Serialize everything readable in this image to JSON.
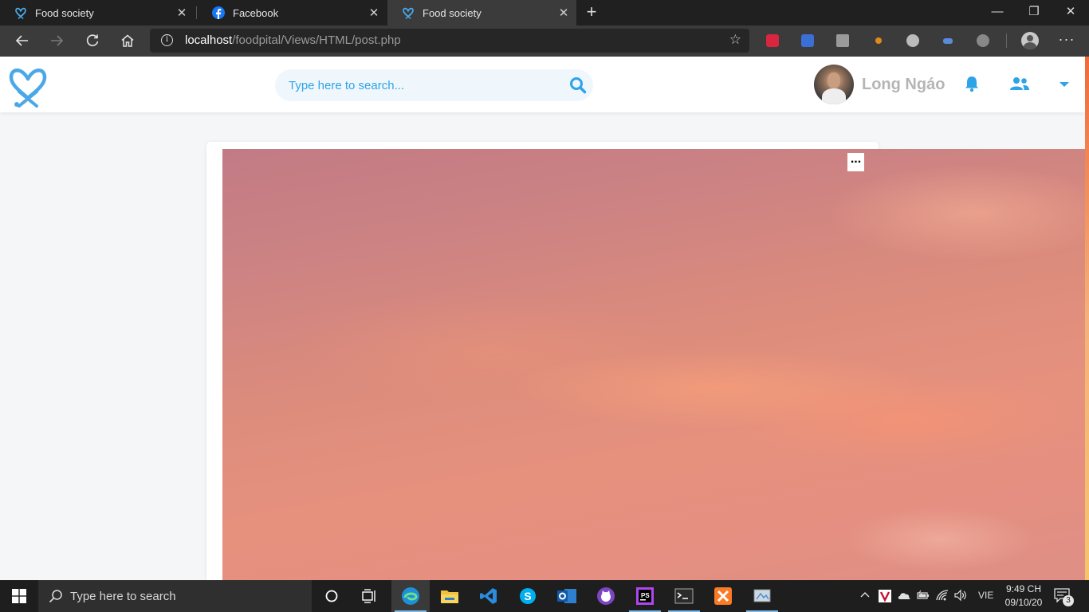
{
  "browser": {
    "tabs": [
      {
        "title": "Food society",
        "active": false,
        "favicon": "food-society-logo-icon"
      },
      {
        "title": "Facebook",
        "active": false,
        "favicon": "facebook-icon"
      },
      {
        "title": "Food society",
        "active": true,
        "favicon": "food-society-logo-icon"
      }
    ],
    "close_glyph": "✕",
    "new_tab_glyph": "+",
    "window_controls": {
      "minimize": "—",
      "restore": "❐",
      "close": "✕"
    },
    "address": {
      "host": "localhost",
      "path": "/foodpital/Views/HTML/post.php"
    }
  },
  "site": {
    "search": {
      "placeholder": "Type here to search..."
    },
    "user": {
      "name": "Long Ngáo"
    },
    "colors": {
      "accent": "#2ea3e8",
      "logo": "#4aa8e8"
    }
  },
  "post": {
    "menu_label": "..."
  },
  "taskbar": {
    "search_placeholder": "Type here to search",
    "language": "VIE",
    "time": "9:49 CH",
    "date": "09/10/20",
    "notification_count": "3"
  }
}
